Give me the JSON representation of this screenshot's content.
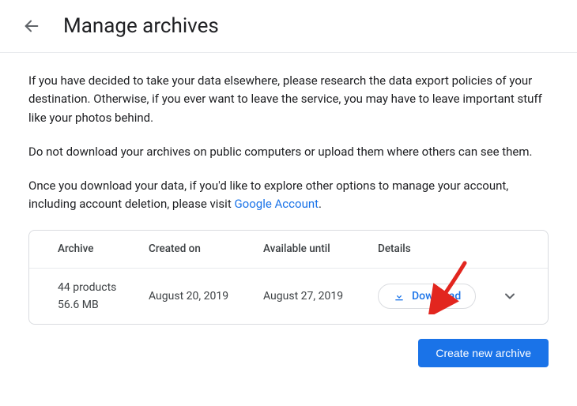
{
  "header": {
    "title": "Manage archives"
  },
  "intro": {
    "p1": "If you have decided to take your data elsewhere, please research the data export policies of your destination. Otherwise, if you ever want to leave the service, you may have to leave important stuff like your photos behind.",
    "p2": "Do not download your archives on public computers or upload them where others can see them.",
    "p3_prefix": "Once you download your data, if you'd like to explore other options to manage your account, including account deletion, please visit ",
    "p3_link": "Google Account",
    "p3_suffix": "."
  },
  "table": {
    "cols": {
      "archive": "Archive",
      "created": "Created on",
      "available": "Available until",
      "details": "Details"
    },
    "row": {
      "products": "44 products",
      "size": "56.6 MB",
      "created": "August 20, 2019",
      "available": "August 27, 2019",
      "download_label": "Download"
    }
  },
  "footer": {
    "create_label": "Create new archive"
  }
}
